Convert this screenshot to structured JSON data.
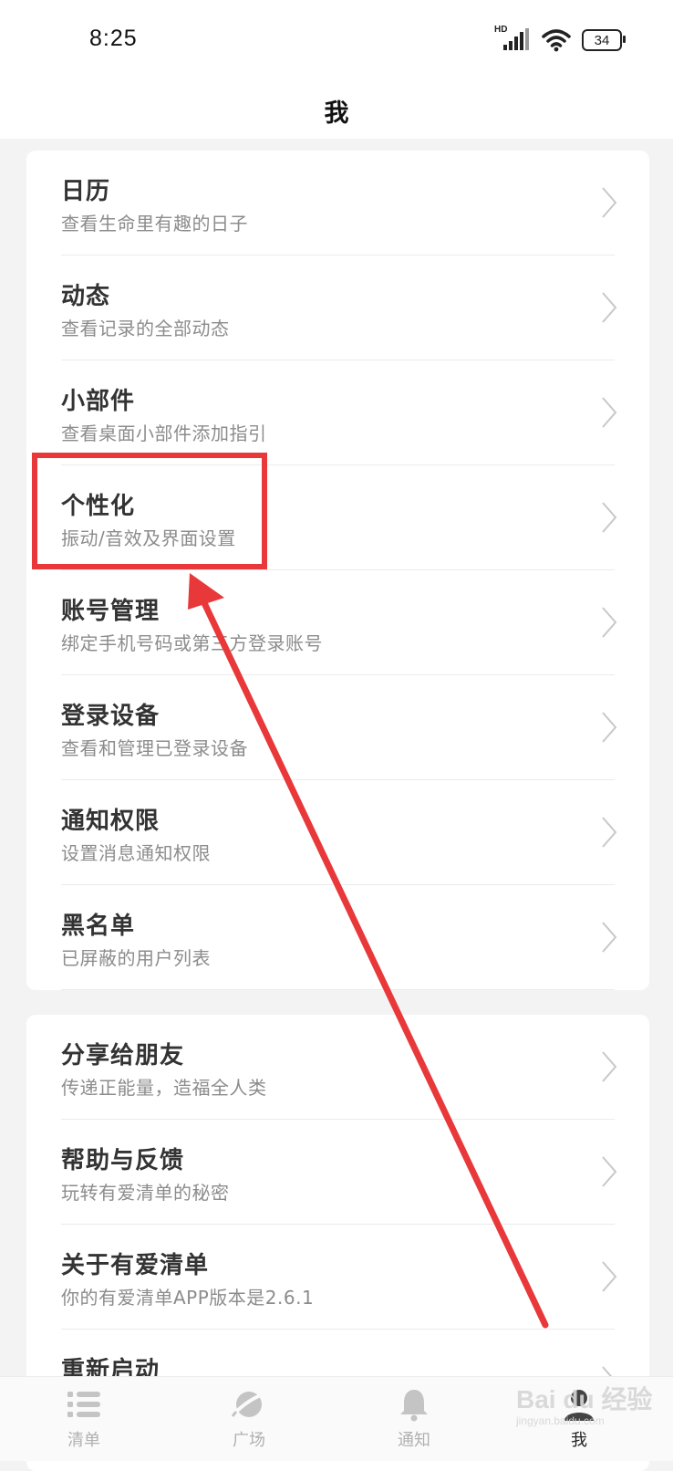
{
  "status_bar": {
    "time": "8:25",
    "network_label": "HD",
    "battery": "34",
    "icons": [
      "signal-icon",
      "wifi-icon",
      "battery-icon"
    ]
  },
  "header": {
    "title": "我"
  },
  "menu_group_1": [
    {
      "title": "日历",
      "subtitle": "查看生命里有趣的日子"
    },
    {
      "title": "动态",
      "subtitle": "查看记录的全部动态"
    },
    {
      "title": "小部件",
      "subtitle": "查看桌面小部件添加指引"
    },
    {
      "title": "个性化",
      "subtitle": "振动/音效及界面设置"
    },
    {
      "title": "账号管理",
      "subtitle": "绑定手机号码或第三方登录账号"
    },
    {
      "title": "登录设备",
      "subtitle": "查看和管理已登录设备"
    },
    {
      "title": "通知权限",
      "subtitle": "设置消息通知权限"
    },
    {
      "title": "黑名单",
      "subtitle": "已屏蔽的用户列表"
    }
  ],
  "menu_group_2": [
    {
      "title": "分享给朋友",
      "subtitle": "传递正能量，造福全人类"
    },
    {
      "title": "帮助与反馈",
      "subtitle": "玩转有爱清单的秘密"
    },
    {
      "title": "关于有爱清单",
      "subtitle": "你的有爱清单APP版本是2.6.1"
    },
    {
      "title": "重新启动",
      "subtitle": ""
    }
  ],
  "tabs": [
    {
      "label": "清单",
      "icon": "list-icon"
    },
    {
      "label": "广场",
      "icon": "planet-icon"
    },
    {
      "label": "通知",
      "icon": "bell-icon"
    },
    {
      "label": "我",
      "icon": "user-icon",
      "active": true
    }
  ],
  "annotation": {
    "highlight_color": "#e8383a"
  },
  "watermark": {
    "brand": "Bai du 经验",
    "url": "jingyan.baidu.com"
  },
  "colors": {
    "background": "#f3f3f3",
    "card": "#ffffff",
    "accent_red": "#e8383a"
  }
}
